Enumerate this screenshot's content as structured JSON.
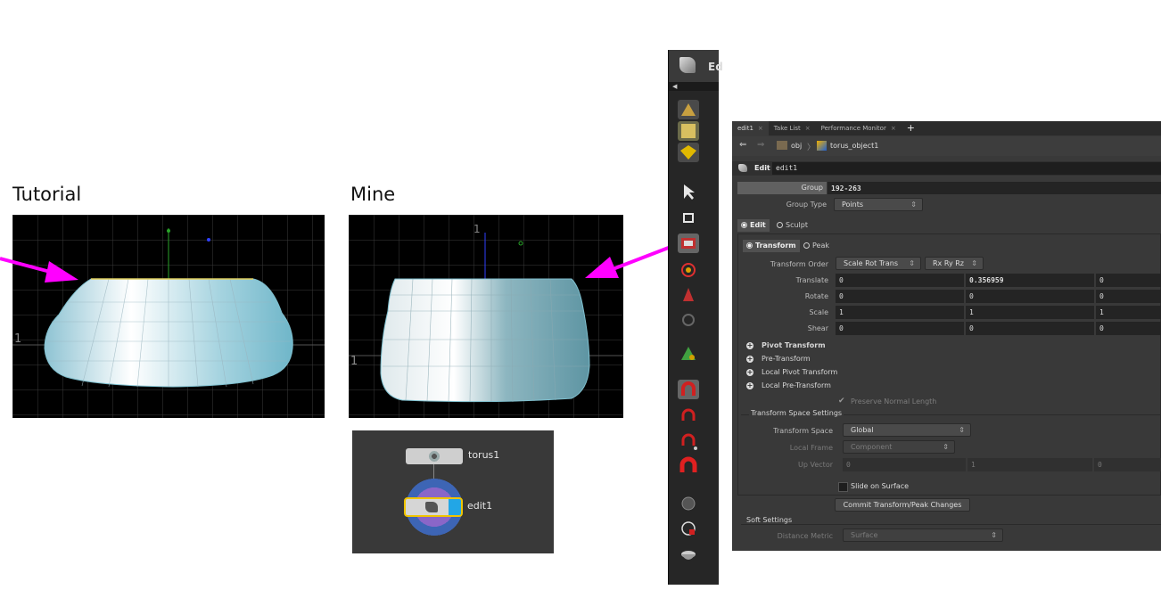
{
  "captions": {
    "tutorial": "Tutorial",
    "mine": "Mine"
  },
  "colors": {
    "arrow": "#ff00ff",
    "mesh": "#b9dbe6",
    "point": "#7fe0e8",
    "node_select": "#f0c400",
    "node_flag": "#22a6e6"
  },
  "tutorial_view": {
    "axis_label": "1"
  },
  "mine_view": {
    "axis_label_top": "1",
    "axis_label_side": "1"
  },
  "node_graph": {
    "nodes": [
      {
        "label": "torus1",
        "icon": "torus-icon"
      },
      {
        "label": "edit1",
        "icon": "edit-brush-icon"
      }
    ]
  },
  "toolbar": {
    "header_label": "Ed",
    "tools": [
      "shelf-lights-icon",
      "shelf-mesh-icon",
      "shelf-cube-icon",
      "select-arrow-icon",
      "handle-icon",
      "edit-tool-icon",
      "rotate-tool-icon",
      "scale-tool-icon",
      "snap-icon",
      "magnet-tool-icon",
      "curve-magnet-icon",
      "point-magnet-icon",
      "magnet-icon",
      "sculpt-icon",
      "globe-icon",
      "bowl-icon"
    ]
  },
  "param_panel": {
    "tabs": [
      {
        "label": "edit1"
      },
      {
        "label": "Take List"
      },
      {
        "label": "Performance Monitor"
      }
    ],
    "add_tab": "+",
    "path": {
      "root": "obj",
      "object": "torus_object1"
    },
    "node_type": "Edit",
    "node_name": "edit1",
    "group": {
      "label": "Group",
      "value": "192-263"
    },
    "group_type": {
      "label": "Group Type",
      "value": "Points"
    },
    "mode_tabs": {
      "edit": "Edit",
      "sculpt": "Sculpt"
    },
    "xform_tabs": {
      "transform": "Transform",
      "peak": "Peak"
    },
    "transform_order": {
      "label": "Transform Order",
      "order": "Scale Rot Trans",
      "rot_order": "Rx Ry Rz"
    },
    "translate": {
      "label": "Translate",
      "x": "0",
      "y": "0.356959",
      "z": "0"
    },
    "rotate": {
      "label": "Rotate",
      "x": "0",
      "y": "0",
      "z": "0"
    },
    "scale": {
      "label": "Scale",
      "x": "1",
      "y": "1",
      "z": "1"
    },
    "shear": {
      "label": "Shear",
      "x": "0",
      "y": "0",
      "z": "0"
    },
    "folders": [
      "Pivot Transform",
      "Pre-Transform",
      "Local Pivot Transform",
      "Local Pre-Transform"
    ],
    "preserve_normal": "Preserve Normal Length",
    "space_settings_title": "Transform Space Settings",
    "transform_space": {
      "label": "Transform Space",
      "value": "Global"
    },
    "local_frame": {
      "label": "Local Frame",
      "value": "Component"
    },
    "up_vector": {
      "label": "Up Vector",
      "x": "0",
      "y": "1",
      "z": "0"
    },
    "slide_on_surface": "Slide on Surface",
    "commit_button": "Commit Transform/Peak Changes",
    "soft_settings_title": "Soft Settings",
    "distance_metric": {
      "label": "Distance Metric",
      "value": "Surface"
    }
  }
}
